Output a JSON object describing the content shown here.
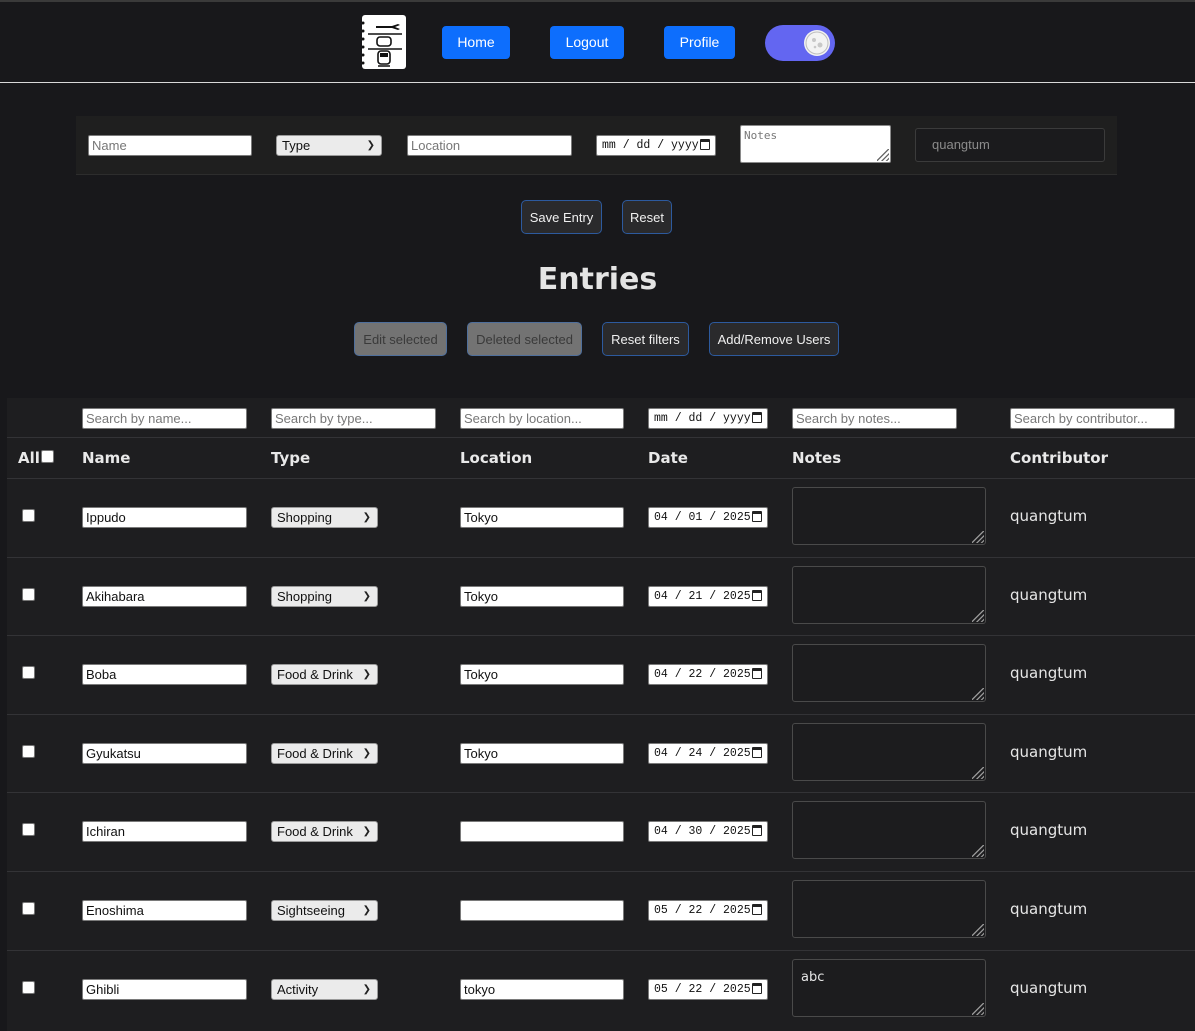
{
  "nav": {
    "home": "Home",
    "logout": "Logout",
    "profile": "Profile",
    "theme_toggle_on": true
  },
  "form": {
    "name_placeholder": "Name",
    "type_selected": "Type",
    "location_placeholder": "Location",
    "date_placeholder": "mm / dd / yyyy",
    "notes_placeholder": "Notes",
    "contributor": "quangtum",
    "save_label": "Save Entry",
    "reset_label": "Reset"
  },
  "entries_title": "Entries",
  "actions": {
    "edit_selected": "Edit selected",
    "delete_selected": "Deleted selected",
    "reset_filters": "Reset filters",
    "add_remove_users": "Add/Remove Users"
  },
  "filters": {
    "name": "Search by name...",
    "type": "Search by type...",
    "location": "Search by location...",
    "date": "mm / dd / yyyy",
    "notes": "Search by notes...",
    "contributor": "Search by contributor..."
  },
  "columns": {
    "all": "All",
    "name": "Name",
    "type": "Type",
    "location": "Location",
    "date": "Date",
    "notes": "Notes",
    "contributor": "Contributor"
  },
  "rows": [
    {
      "name": "Ippudo",
      "type": "Shopping",
      "location": "Tokyo",
      "date": "04 / 01 / 2025",
      "notes": "",
      "contributor": "quangtum"
    },
    {
      "name": "Akihabara",
      "type": "Shopping",
      "location": "Tokyo",
      "date": "04 / 21 / 2025",
      "notes": "",
      "contributor": "quangtum"
    },
    {
      "name": "Boba",
      "type": "Food & Drink",
      "location": "Tokyo",
      "date": "04 / 22 / 2025",
      "notes": "",
      "contributor": "quangtum"
    },
    {
      "name": "Gyukatsu",
      "type": "Food & Drink",
      "location": "Tokyo",
      "date": "04 / 24 / 2025",
      "notes": "",
      "contributor": "quangtum"
    },
    {
      "name": "Ichiran",
      "type": "Food & Drink",
      "location": "",
      "date": "04 / 30 / 2025",
      "notes": "",
      "contributor": "quangtum"
    },
    {
      "name": "Enoshima",
      "type": "Sightseeing",
      "location": "",
      "date": "05 / 22 / 2025",
      "notes": "",
      "contributor": "quangtum"
    },
    {
      "name": "Ghibli",
      "type": "Activity",
      "location": "tokyo",
      "date": "05 / 22 / 2025",
      "notes": "abc",
      "contributor": "quangtum"
    }
  ]
}
